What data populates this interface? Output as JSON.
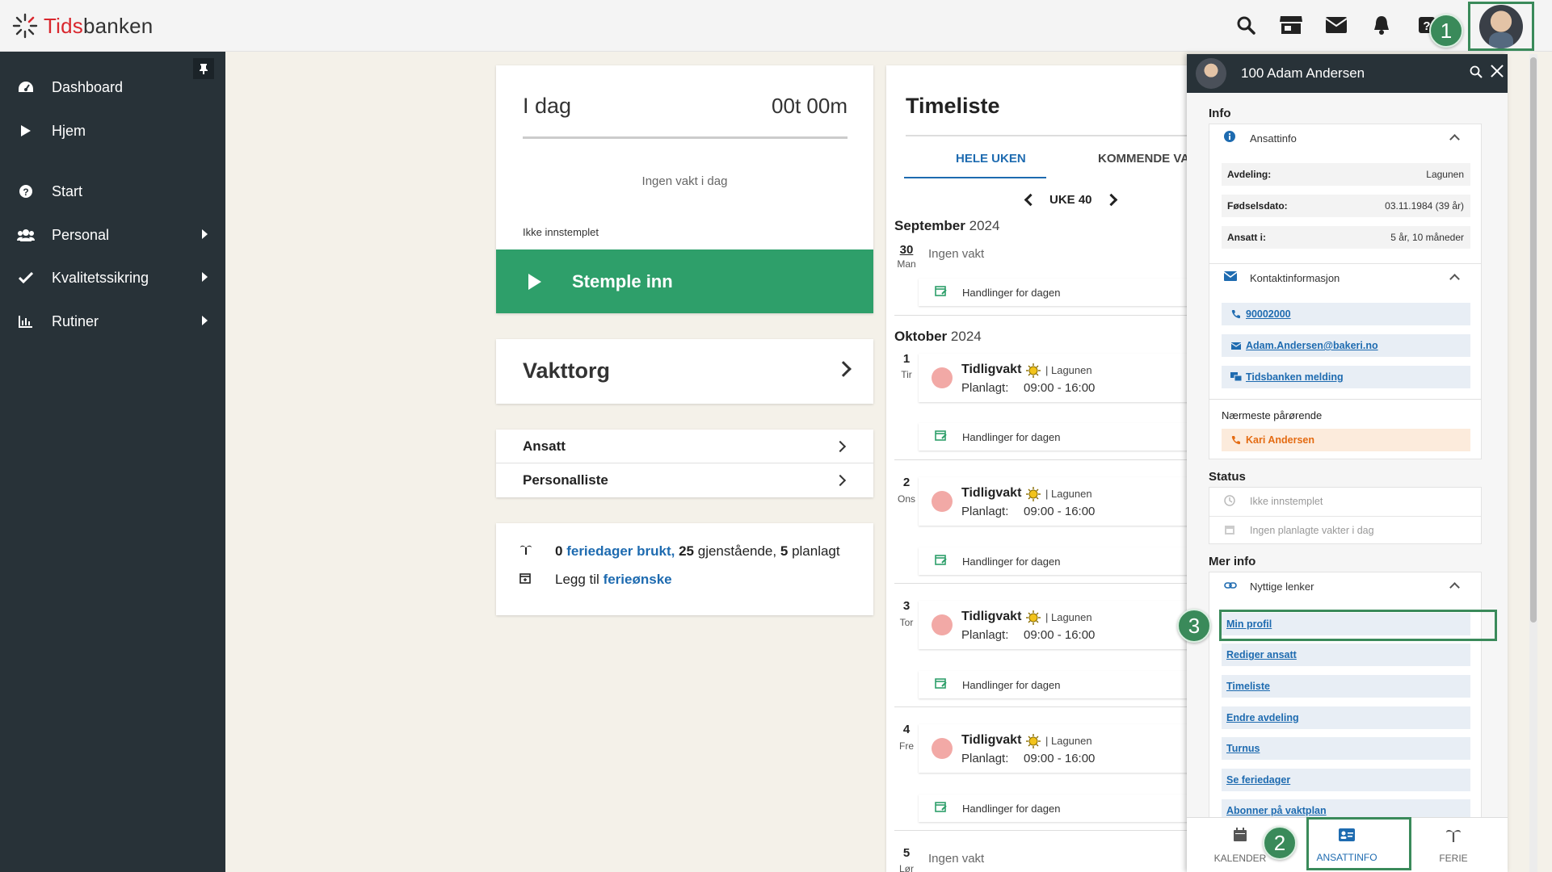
{
  "brand": {
    "name_prefix": "Tids",
    "name_suffix": "banken"
  },
  "header": {
    "icons": [
      "search-icon",
      "store-icon",
      "mail-icon",
      "bell-icon",
      "help-icon"
    ],
    "step_badges": {
      "one": "1",
      "two": "2",
      "three": "3"
    }
  },
  "sidebar": {
    "items": [
      {
        "label": "Dashboard",
        "icon": "dashboard-icon"
      },
      {
        "label": "Hjem",
        "icon": "play-icon"
      },
      {
        "label": "Start",
        "icon": "question-icon"
      },
      {
        "label": "Personal",
        "icon": "users-icon"
      },
      {
        "label": "Kvalitetssikring",
        "icon": "check-icon"
      },
      {
        "label": "Rutiner",
        "icon": "chart-icon"
      }
    ]
  },
  "today": {
    "title": "I dag",
    "time": "00t 00m",
    "no_shift": "Ingen vakt i dag",
    "status": "Ikke innstemplet",
    "stamp_label": "Stemple inn"
  },
  "vakttorg": {
    "label": "Vakttorg"
  },
  "quicklinks": {
    "ansatt": "Ansatt",
    "personalliste": "Personalliste"
  },
  "vacation": {
    "used_count": "0",
    "used_label": "feriedager brukt,",
    "remaining_count": "25",
    "remaining_label": "gjenstående,",
    "planned_count": "5",
    "planned_label": "planlagt",
    "add_prefix": "Legg til",
    "add_link": "ferieønske"
  },
  "timeliste": {
    "title": "Timeliste",
    "tab_all": "HELE UKEN",
    "tab_upcoming": "KOMMENDE VA",
    "week": "UKE 40",
    "month1": "September",
    "year1": "2024",
    "month2": "Oktober",
    "year2": "2024",
    "handl_label": "Handlinger for dagen",
    "no_shift": "Ingen vakt",
    "shift_name": "Tidligvakt",
    "shift_dept": "| Lagunen",
    "planned_label": "Planlagt:",
    "planned_time": "09:00 - 16:00",
    "days": [
      {
        "num": "30",
        "name": "Man"
      },
      {
        "num": "1",
        "name": "Tir"
      },
      {
        "num": "2",
        "name": "Ons"
      },
      {
        "num": "3",
        "name": "Tor"
      },
      {
        "num": "4",
        "name": "Fre"
      },
      {
        "num": "5",
        "name": "Lør"
      }
    ]
  },
  "panel": {
    "title": "100 Adam Andersen",
    "info_title": "Info",
    "ansattinfo": "Ansattinfo",
    "fields": [
      {
        "key": "Avdeling:",
        "value": "Lagunen"
      },
      {
        "key": "Fødselsdato:",
        "value": "03.11.1984 (39 år)"
      },
      {
        "key": "Ansatt i:",
        "value": "5 år, 10 måneder"
      }
    ],
    "contact_title": "Kontaktinformasjon",
    "phone": "90002000",
    "email": "Adam.Andersen@bakeri.no",
    "message": "Tidsbanken melding",
    "next_of_kin_label": "Nærmeste pårørende",
    "next_of_kin": "Kari Andersen",
    "status_title": "Status",
    "status_stamp": "Ikke innstemplet",
    "status_shifts": "Ingen planlagte vakter i dag",
    "more_title": "Mer info",
    "useful_links": "Nyttige lenker",
    "links": [
      "Min profil",
      "Rediger ansatt",
      "Timeliste",
      "Endre avdeling",
      "Turnus",
      "Se feriedager",
      "Abonner på vaktplan"
    ],
    "bottom_tabs": {
      "calendar": "KALENDER",
      "ansattinfo": "ANSATTINFO",
      "ferie": "FERIE"
    }
  },
  "colors": {
    "sidebar": "#283238",
    "accent_green": "#2e9f6a",
    "link_blue": "#1e6bb0",
    "highlight_green": "#3a8a5a",
    "shift_dot": "#f2a9a6"
  }
}
